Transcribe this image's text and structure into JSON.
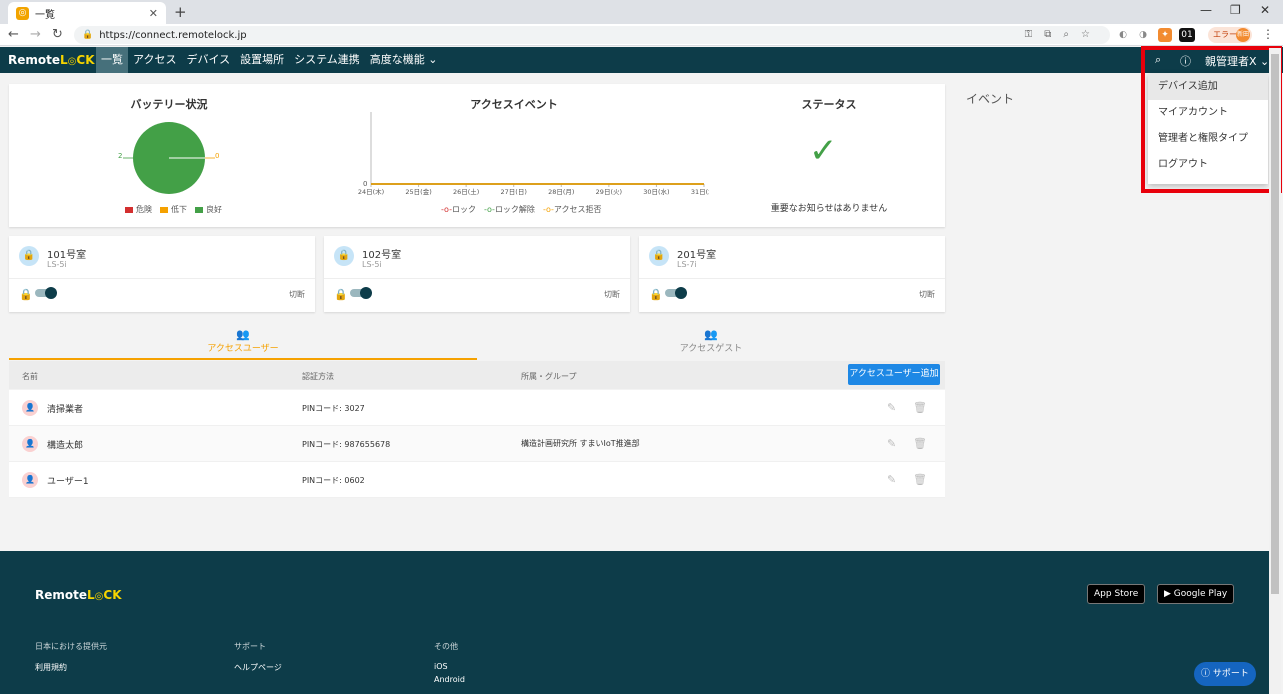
{
  "browser": {
    "tab_title": "一覧",
    "tab_favicon_glyph": "◎",
    "url": "https://connect.remotelock.jp",
    "error_label": "エラー",
    "avatar_text": "新田",
    "ext_label": "01"
  },
  "header": {
    "logo_a": "Remote",
    "logo_b": "L",
    "logo_c": "CK",
    "nav": [
      "一覧",
      "アクセス",
      "デバイス",
      "設置場所",
      "システム連携",
      "高度な機能"
    ],
    "user": "親管理者X"
  },
  "dropdown": {
    "items": [
      "デバイス追加",
      "マイアカウント",
      "管理者と権限タイプ",
      "ログアウト"
    ]
  },
  "battery": {
    "title": "バッテリー状況",
    "left_value": "2",
    "right_value": "0",
    "legend": [
      "危険",
      "低下",
      "良好"
    ],
    "colors": [
      "#d32f2f",
      "#f5a100",
      "#43a047"
    ]
  },
  "chart_data": {
    "type": "line",
    "title": "アクセスイベント",
    "categories": [
      "24日(木)",
      "25日(金)",
      "26日(土)",
      "27日(日)",
      "28日(月)",
      "29日(火)",
      "30日(水)",
      "31日(木)"
    ],
    "series": [
      {
        "name": "ロック",
        "values": [
          0,
          0,
          0,
          0,
          0,
          0,
          0,
          0
        ]
      },
      {
        "name": "ロック解除",
        "values": [
          0,
          0,
          0,
          0,
          0,
          0,
          0,
          0
        ]
      },
      {
        "name": "アクセス拒否",
        "values": [
          0,
          0,
          0,
          0,
          0,
          0,
          0,
          0
        ]
      }
    ],
    "y_tick_label": "0",
    "series_colors": [
      "#d32f2f",
      "#43a047",
      "#f5a100"
    ]
  },
  "status": {
    "title": "ステータス",
    "message": "重要なお知らせはありません"
  },
  "events_label": "イベント",
  "devices": [
    {
      "name": "101号室",
      "model": "LS-5i",
      "state": "切断"
    },
    {
      "name": "102号室",
      "model": "LS-5i",
      "state": "切断"
    },
    {
      "name": "201号室",
      "model": "LS-7i",
      "state": "切断"
    }
  ],
  "tabs": {
    "users": "アクセスユーザー",
    "guests": "アクセスゲスト"
  },
  "table": {
    "headers": [
      "名前",
      "認証方法",
      "所属・グループ"
    ],
    "add_button": "アクセスユーザー追加",
    "rows": [
      {
        "name": "清掃業者",
        "pin": "PINコード: 3027",
        "group": ""
      },
      {
        "name": "構造太郎",
        "pin": "PINコード: 987655678",
        "group": "構造計画研究所 すまいIoT推進部"
      },
      {
        "name": "ユーザー1",
        "pin": "PINコード: 0602",
        "group": ""
      }
    ]
  },
  "footer": {
    "logo_a": "Remote",
    "logo_b": "L",
    "logo_c": "CK",
    "app_store": "App Store",
    "google_play": "Google Play",
    "col1_head": "日本における提供元",
    "col1_item": "利用規約",
    "col2_head": "サポート",
    "col2_item": "ヘルプページ",
    "col3_head": "その他",
    "col3_items": [
      "iOS",
      "Android"
    ],
    "support_button": "サポート"
  }
}
